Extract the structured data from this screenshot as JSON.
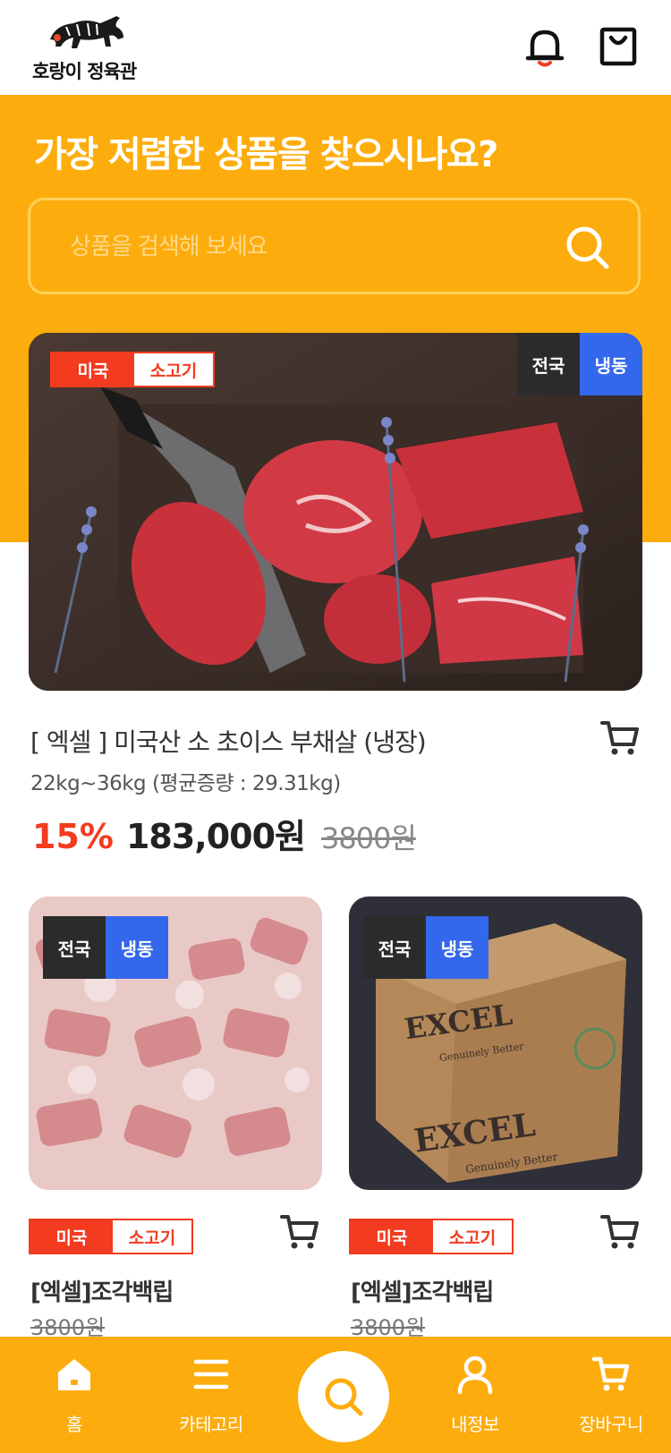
{
  "header": {
    "logo_text": "호랑이 정육관",
    "icons": [
      "bell-icon",
      "shopping-bag-icon"
    ]
  },
  "hero": {
    "title": "가장 저렴한 상품을 찾으시나요?",
    "search_placeholder": "상품을 검색해 보세요"
  },
  "featured": {
    "origin_tag": [
      "미국",
      "소고기"
    ],
    "ship_tag": [
      "전국",
      "냉동"
    ],
    "title": "[ 엑셀 ] 미국산 소 초이스 부채살 (냉장)",
    "weight": "22kg~36kg (평균증량 : 29.31kg)",
    "discount": "15%",
    "price": "183,000원",
    "original_price": "3800원"
  },
  "products": [
    {
      "ship_tag": [
        "전국",
        "냉동"
      ],
      "origin_tag": [
        "미국",
        "소고기"
      ],
      "title": "[엑셀]조각백립",
      "original_price": "3800원"
    },
    {
      "ship_tag": [
        "전국",
        "냉동"
      ],
      "origin_tag": [
        "미국",
        "소고기"
      ],
      "title": "[엑셀]조각백립",
      "original_price": "3800원",
      "box_text": [
        "EXCEL",
        "Genuinely Better",
        "EXCEL",
        "Genuinely Better"
      ]
    }
  ],
  "bottom_nav": {
    "items": [
      {
        "label": "홈",
        "icon": "home-icon"
      },
      {
        "label": "카테고리",
        "icon": "menu-icon"
      },
      {
        "label": "",
        "icon": "search-icon"
      },
      {
        "label": "내정보",
        "icon": "user-icon"
      },
      {
        "label": "장바구니",
        "icon": "cart-icon"
      }
    ]
  },
  "colors": {
    "brand_yellow": "#fcad0d",
    "accent_red": "#f23b1f",
    "frozen_blue": "#3468ec",
    "dark_tag": "#2b2b2b"
  }
}
